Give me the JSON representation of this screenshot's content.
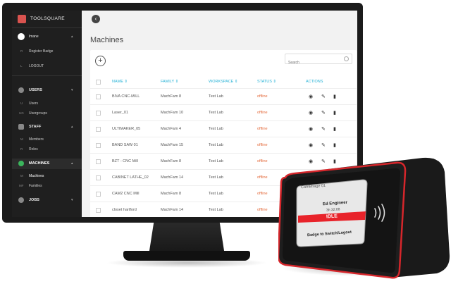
{
  "app": {
    "brand": "TOOLSQUARE"
  },
  "sidebar": {
    "user": {
      "name": "lmane"
    },
    "user_items": [
      {
        "abbr": "R",
        "label": "Register Badge"
      },
      {
        "abbr": "L",
        "label": "LOGOUT"
      }
    ],
    "sections": [
      {
        "label": "USERS",
        "items": [
          {
            "abbr": "U",
            "label": "Users"
          },
          {
            "abbr": "UG",
            "label": "Usergroups"
          }
        ]
      },
      {
        "label": "STAFF",
        "items": [
          {
            "abbr": "M",
            "label": "Members"
          },
          {
            "abbr": "R",
            "label": "Roles"
          }
        ]
      },
      {
        "label": "MACHINES",
        "items": [
          {
            "abbr": "M",
            "label": "Machines"
          },
          {
            "abbr": "MF",
            "label": "Families"
          }
        ]
      },
      {
        "label": "JOBS",
        "items": []
      }
    ]
  },
  "page": {
    "title": "Machines"
  },
  "search": {
    "placeholder": "Search"
  },
  "table": {
    "headers": [
      "NAME",
      "FAMILY",
      "WORKSPACE",
      "STATUS",
      "ACTIONS"
    ],
    "rows": [
      {
        "name": "BIVA CNC-MILL",
        "family": "MachFam 8",
        "workspace": "Test Lab",
        "status": "offline"
      },
      {
        "name": "Laser_01",
        "family": "MachFam 10",
        "workspace": "Test Lab",
        "status": "offline"
      },
      {
        "name": "ULTIMAKER_05",
        "family": "MachFam 4",
        "workspace": "Test Lab",
        "status": "offline"
      },
      {
        "name": "BAND SAW 01",
        "family": "MachFam 15",
        "workspace": "Test Lab",
        "status": "offline"
      },
      {
        "name": "BZT - CNC Mill",
        "family": "MachFam 8",
        "workspace": "Test Lab",
        "status": "offline"
      },
      {
        "name": "CABINET LATHE_02",
        "family": "MachFam 14",
        "workspace": "Test Lab",
        "status": "offline"
      },
      {
        "name": "CAM2 CNC Mill",
        "family": "MachFam 8",
        "workspace": "Test Lab",
        "status": "offline"
      },
      {
        "name": "closet hartford",
        "family": "MachFam 14",
        "workspace": "Test Lab",
        "status": "offline"
      }
    ]
  },
  "device": {
    "machine": "CamBhage 01",
    "user": "Ed Engineer",
    "time": "3h 32:08",
    "state": "IDLE",
    "prompt": "Badge to Switch/Logout"
  },
  "colors": {
    "accent": "#27b2d6",
    "status_offline": "#e46a3b",
    "brand": "#d9534f",
    "device_red": "#e8232a"
  }
}
